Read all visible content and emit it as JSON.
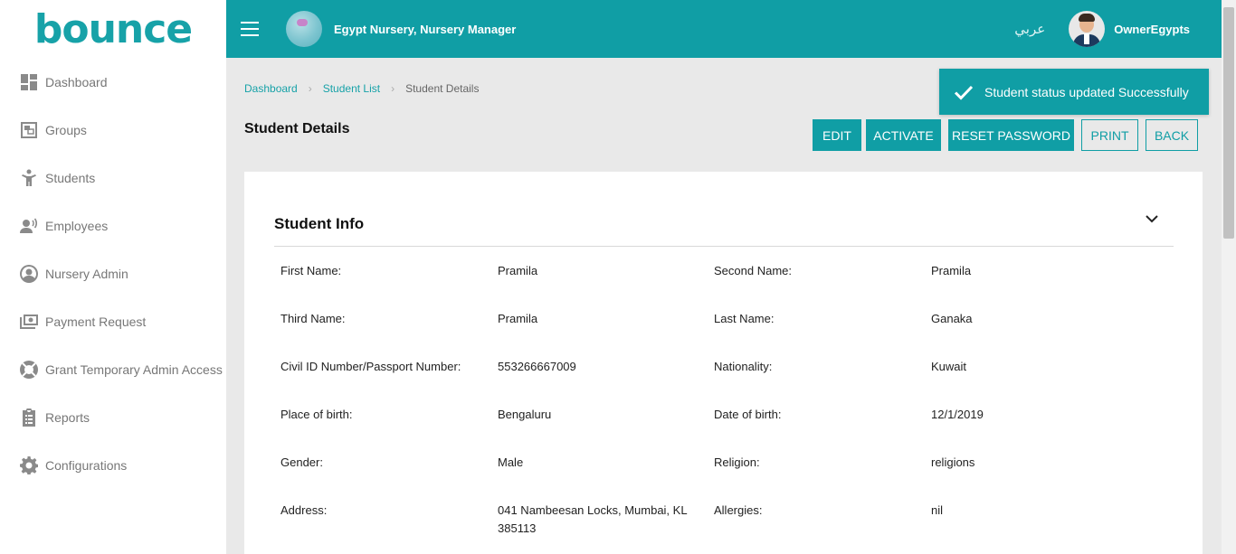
{
  "brand": {
    "logo_text": "bounce"
  },
  "sidebar": {
    "items": [
      {
        "label": "Dashboard"
      },
      {
        "label": "Groups"
      },
      {
        "label": "Students"
      },
      {
        "label": "Employees"
      },
      {
        "label": "Nursery Admin"
      },
      {
        "label": "Payment Request"
      },
      {
        "label": "Grant Temporary Admin Access"
      },
      {
        "label": "Reports"
      },
      {
        "label": "Configurations"
      }
    ]
  },
  "header": {
    "org_title": "Egypt Nursery, Nursery Manager",
    "language_toggle": "عربي",
    "username": "OwnerEgypts"
  },
  "breadcrumb": {
    "items": [
      "Dashboard",
      "Student List",
      "Student Details"
    ]
  },
  "page": {
    "title": "Student Details",
    "buttons": {
      "edit": "EDIT",
      "activate": "ACTIVATE",
      "reset_password": "RESET PASSWORD",
      "print": "PRINT",
      "back": "BACK"
    }
  },
  "toast": {
    "message": "Student status updated Successfully"
  },
  "student_info": {
    "title": "Student Info",
    "fields": [
      {
        "label": "First Name:",
        "value": "Pramila"
      },
      {
        "label": "Second Name:",
        "value": "Pramila"
      },
      {
        "label": "Third Name:",
        "value": "Pramila"
      },
      {
        "label": "Last Name:",
        "value": "Ganaka"
      },
      {
        "label": "Civil ID Number/Passport Number:",
        "value": "553266667009"
      },
      {
        "label": "Nationality:",
        "value": "Kuwait"
      },
      {
        "label": "Place of birth:",
        "value": "Bengaluru"
      },
      {
        "label": "Date of birth:",
        "value": "12/1/2019"
      },
      {
        "label": "Gender:",
        "value": "Male"
      },
      {
        "label": "Religion:",
        "value": "religions"
      },
      {
        "label": "Address:",
        "value": "041 Nambeesan Locks, Mumbai, KL 385113"
      },
      {
        "label": "Allergies:",
        "value": "nil"
      }
    ]
  },
  "colors": {
    "primary": "#109ea5",
    "brand_accent": "#b9d536",
    "sidebar_text": "#777777",
    "content_bg": "#e9e9e9"
  }
}
